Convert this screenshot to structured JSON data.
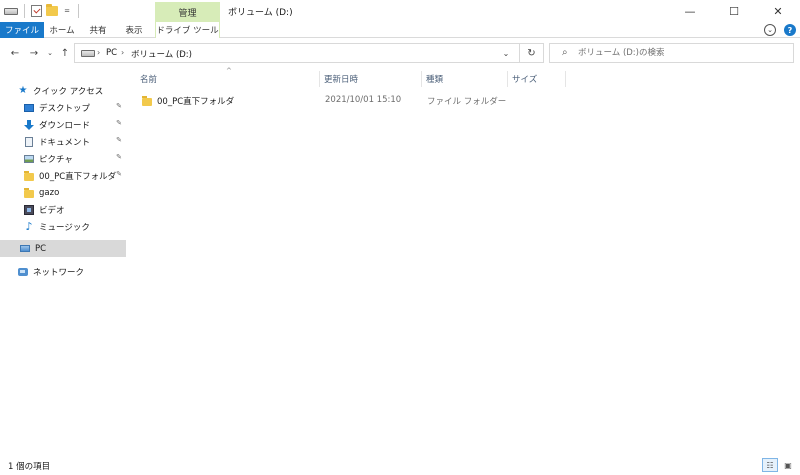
{
  "titlebar": {
    "context_tab": "管理",
    "window_title": "ボリューム (D:)",
    "qat_dropdown_glyph": "=",
    "minimize_glyph": "—",
    "maximize_glyph": "☐",
    "close_glyph": "✕"
  },
  "ribbon": {
    "tabs": [
      {
        "label": "ファイル"
      },
      {
        "label": "ホーム"
      },
      {
        "label": "共有"
      },
      {
        "label": "表示"
      },
      {
        "label": "ドライブ ツール"
      }
    ],
    "expand_glyph": "⌄",
    "help_glyph": "?"
  },
  "nav": {
    "back_glyph": "←",
    "forward_glyph": "→",
    "recent_glyph": "⌄",
    "up_glyph": "↑",
    "breadcrumb": [
      "PC",
      "ボリューム (D:)"
    ],
    "crumb_sep": "›",
    "address_dropdown_glyph": "⌄",
    "refresh_glyph": "↻",
    "search_placeholder": "ボリューム (D:)の検索",
    "search_glyph": "⌕"
  },
  "navpane": {
    "items": [
      {
        "label": "クイック アクセス",
        "icon": "star-icon"
      },
      {
        "label": "デスクトップ",
        "icon": "desktop-icon",
        "pinned": true
      },
      {
        "label": "ダウンロード",
        "icon": "download-icon",
        "pinned": true
      },
      {
        "label": "ドキュメント",
        "icon": "document-icon",
        "pinned": true
      },
      {
        "label": "ピクチャ",
        "icon": "picture-icon",
        "pinned": true
      },
      {
        "label": "00_PC直下フォルダ",
        "icon": "folder-icon",
        "pinned": true
      },
      {
        "label": "gazo",
        "icon": "folder-icon"
      },
      {
        "label": "ビデオ",
        "icon": "video-icon"
      },
      {
        "label": "ミュージック",
        "icon": "music-icon"
      },
      {
        "label": "PC",
        "icon": "pc-icon",
        "selected": true
      },
      {
        "label": "ネットワーク",
        "icon": "network-icon"
      }
    ],
    "pin_glyph": "✎"
  },
  "content": {
    "columns": [
      {
        "label": "名前"
      },
      {
        "label": "更新日時"
      },
      {
        "label": "種類"
      },
      {
        "label": "サイズ"
      }
    ],
    "sort_glyph": "^",
    "rows": [
      {
        "name": "00_PC直下フォルダ",
        "modified": "2021/10/01 15:10",
        "type": "ファイル フォルダー",
        "size": ""
      }
    ]
  },
  "status": {
    "item_count": "1 個の項目",
    "details_view_glyph": "☷",
    "large_icons_glyph": "▣"
  },
  "colors": {
    "file_tab": "#1979ca",
    "context_tab": "#d7ecb8",
    "selected_nav": "#d9d9d9"
  }
}
